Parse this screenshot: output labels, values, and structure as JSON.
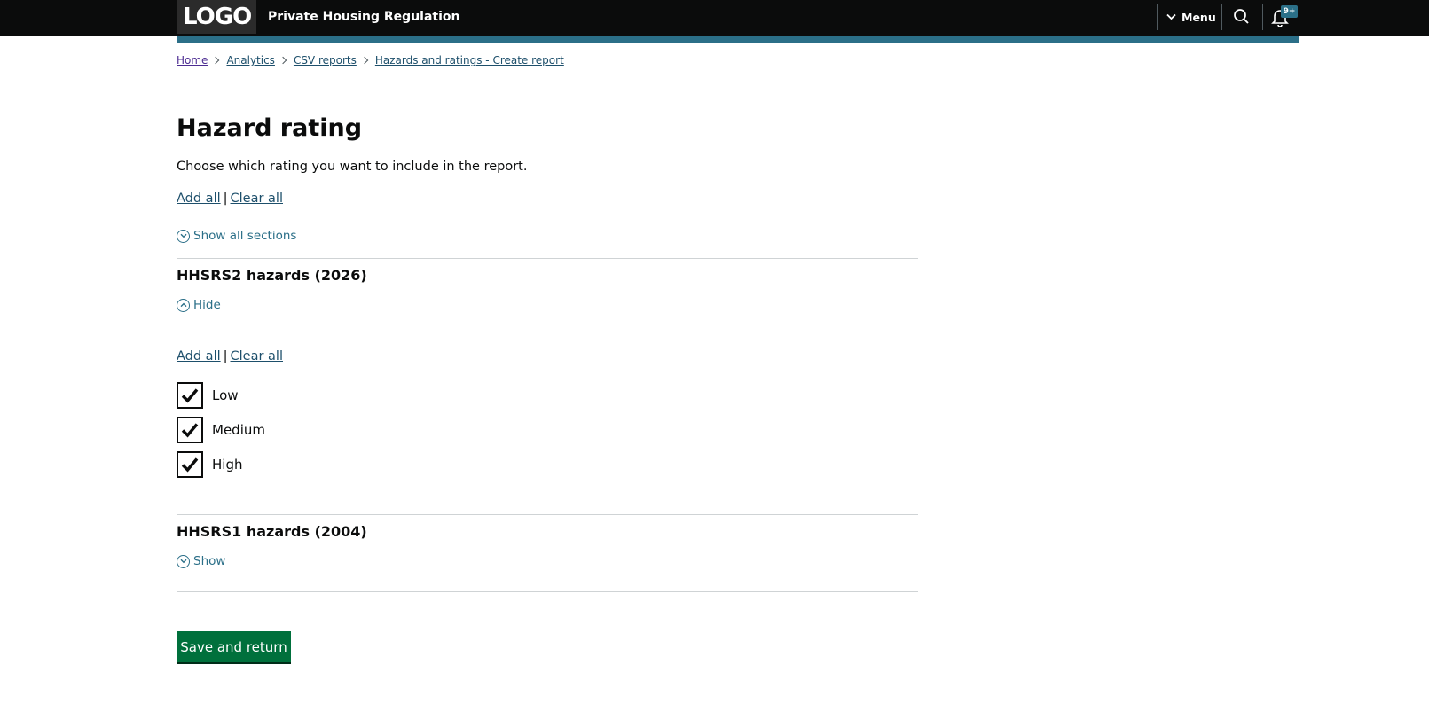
{
  "header": {
    "logo_text": "LOGO",
    "service_name": "Private Housing Regulation",
    "menu_label": "Menu",
    "notification_count": "9+",
    "accent_color": "#2b6f88"
  },
  "breadcrumb": [
    "Home",
    "Analytics",
    "CSV reports",
    "Hazards and ratings - Create report"
  ],
  "page": {
    "title": "Hazard rating",
    "hint": "Choose which rating you want to include in the report.",
    "add_all": "Add all",
    "clear_all": "Clear all",
    "separator": "|",
    "show_all_sections": "Show all sections"
  },
  "sections": [
    {
      "heading": "HHSRS2 hazards (2026)",
      "toggle_label": "Hide",
      "expanded": true,
      "add_all": "Add all",
      "clear_all": "Clear all",
      "options": [
        {
          "label": "Low",
          "checked": true
        },
        {
          "label": "Medium",
          "checked": true
        },
        {
          "label": "High",
          "checked": true
        }
      ]
    },
    {
      "heading": "HHSRS1 hazards (2004)",
      "toggle_label": "Show",
      "expanded": false
    }
  ],
  "actions": {
    "save_label": "Save and return",
    "save_color": "#00703c"
  }
}
